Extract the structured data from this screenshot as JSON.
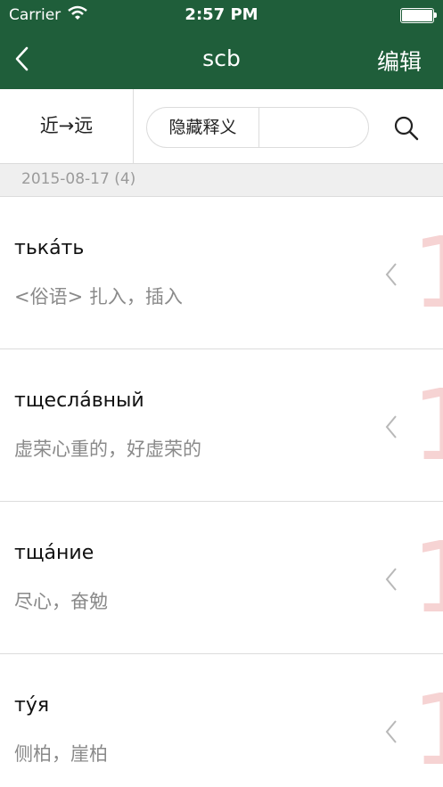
{
  "status_bar": {
    "carrier": "Carrier",
    "time": "2:57 PM"
  },
  "nav": {
    "title": "scb",
    "edit_label": "编辑"
  },
  "toolbar": {
    "sort_label": "近→远",
    "filter_label": "隐藏释义"
  },
  "section": {
    "label": "2015-08-17 (4)"
  },
  "rows": [
    {
      "word": "тька́ть",
      "definition": "<俗语> 扎入，插入",
      "marker": "1"
    },
    {
      "word": "тщесла́вный",
      "definition": "虚荣心重的，好虚荣的",
      "marker": "1"
    },
    {
      "word": "тща́ние",
      "definition": "尽心，奋勉",
      "marker": "1"
    },
    {
      "word": "ту́я",
      "definition": "侧柏，崖柏",
      "marker": "1"
    }
  ],
  "colors": {
    "header_bg": "#1f5e3a",
    "marker": "#f6d3d3"
  }
}
